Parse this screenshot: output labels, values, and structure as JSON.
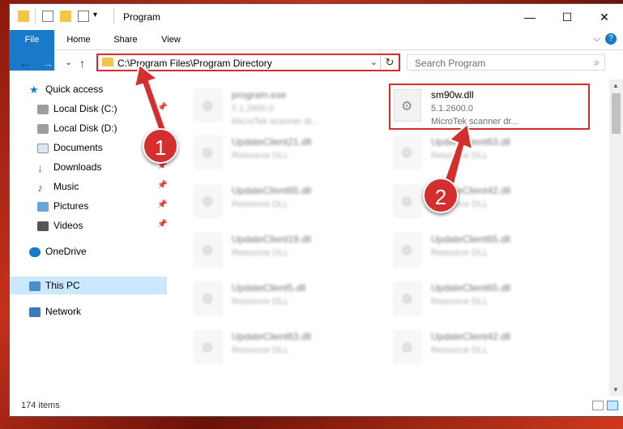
{
  "window": {
    "title": "Program"
  },
  "titlebar": {
    "minimize": "—",
    "maximize": "☐",
    "close": "✕"
  },
  "ribbon": {
    "tabs": [
      "File",
      "Home",
      "Share",
      "View"
    ],
    "expand": "⌵",
    "help": "?"
  },
  "nav": {
    "back": "←",
    "forward": "→",
    "recent": "⌄",
    "up": "↑",
    "address": "C:\\Program Files\\Program Directory",
    "search_placeholder": "Search Program"
  },
  "sidebar": {
    "items": [
      {
        "label": "Quick access",
        "icon": "star-icon"
      },
      {
        "label": "Local Disk (C:)",
        "icon": "drive-icon"
      },
      {
        "label": "Local Disk (D:)",
        "icon": "drive-icon"
      },
      {
        "label": "Documents",
        "icon": "documents-icon"
      },
      {
        "label": "Downloads",
        "icon": "download-icon"
      },
      {
        "label": "Music",
        "icon": "music-icon"
      },
      {
        "label": "Pictures",
        "icon": "pictures-icon"
      },
      {
        "label": "Videos",
        "icon": "videos-icon"
      },
      {
        "label": "OneDrive",
        "icon": "cloud-icon"
      },
      {
        "label": "This PC",
        "icon": "computer-icon"
      },
      {
        "label": "Network",
        "icon": "network-icon"
      }
    ]
  },
  "files": [
    {
      "name": "program.exe",
      "sub1": "5.1.2600.0",
      "sub2": "MicroTek scanner dr..."
    },
    {
      "name": "sm90w.dll",
      "sub1": "5.1.2600.0",
      "sub2": "MicroTek scanner dr..."
    },
    {
      "name": "UpdateClient21.dll",
      "sub1": "Resource DLL"
    },
    {
      "name": "UpdateClient63.dll",
      "sub1": "Resource DLL"
    },
    {
      "name": "UpdateClient65.dll",
      "sub1": "Resource DLL"
    },
    {
      "name": "UpdateClient42.dll",
      "sub1": "Resource DLL"
    },
    {
      "name": "UpdateClient19.dll",
      "sub1": "Resource DLL"
    },
    {
      "name": "UpdateClient65.dll",
      "sub1": "Resource DLL"
    },
    {
      "name": "UpdateClient5.dll",
      "sub1": "Resource DLL"
    },
    {
      "name": "UpdateClient65.dll",
      "sub1": "Resource DLL"
    },
    {
      "name": "UpdateClient63.dll",
      "sub1": "Resource DLL"
    },
    {
      "name": "UpdateClient42.dll",
      "sub1": "Resource DLL"
    }
  ],
  "status": {
    "items": "174 items"
  },
  "annotations": {
    "badge1": "1",
    "badge2": "2",
    "color": "#d32f2f"
  }
}
